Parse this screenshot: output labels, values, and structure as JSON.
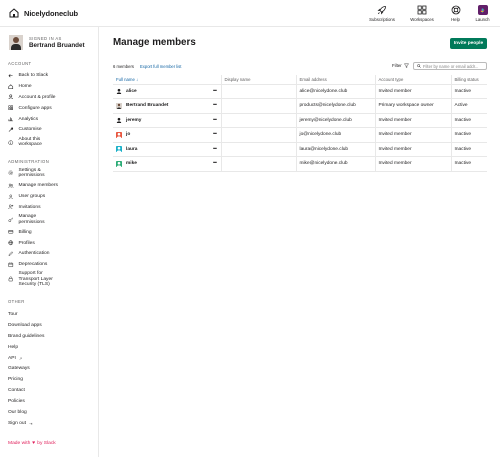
{
  "app": {
    "brand": "Nicelydoneclub"
  },
  "topnav": [
    {
      "label": "Subscriptions",
      "icon": "rocket-icon"
    },
    {
      "label": "Workspaces",
      "icon": "grid-icon"
    },
    {
      "label": "Help",
      "icon": "lifebuoy-icon"
    },
    {
      "label": "Launch",
      "icon": "slack-icon"
    }
  ],
  "user": {
    "signed_in_label": "SIGNED IN AS",
    "name": "Bertrand Bruandet"
  },
  "sidebar": {
    "account_heading": "ACCOUNT",
    "account_items": [
      {
        "label": "Back to Slack",
        "icon": "arrow-left-icon"
      },
      {
        "label": "Home",
        "icon": "home-icon"
      },
      {
        "label": "Account & profile",
        "icon": "user-icon"
      },
      {
        "label": "Configure apps",
        "icon": "apps-icon"
      },
      {
        "label": "Analytics",
        "icon": "chart-icon"
      },
      {
        "label": "Customise",
        "icon": "wrench-icon"
      },
      {
        "label": "About this workspace",
        "icon": "info-icon"
      }
    ],
    "admin_heading": "ADMINISTRATION",
    "admin_items": [
      {
        "label": "Settings & permissions",
        "icon": "gear-icon"
      },
      {
        "label": "Manage members",
        "icon": "users-icon"
      },
      {
        "label": "User groups",
        "icon": "user-group-icon"
      },
      {
        "label": "Invitations",
        "icon": "invite-icon"
      },
      {
        "label": "Manage permissions",
        "icon": "key-icon"
      },
      {
        "label": "Billing",
        "icon": "card-icon"
      },
      {
        "label": "Profiles",
        "icon": "globe-icon"
      },
      {
        "label": "Authentication",
        "icon": "pencil-icon"
      },
      {
        "label": "Deprecations",
        "icon": "calendar-icon"
      },
      {
        "label": "Support for Transport Layer Security (TLS)",
        "icon": "lock-icon"
      }
    ],
    "other_heading": "OTHER",
    "other_items": [
      {
        "label": "Tour",
        "external": false
      },
      {
        "label": "Download apps",
        "external": false
      },
      {
        "label": "Brand guidelines",
        "external": false
      },
      {
        "label": "Help",
        "external": false
      },
      {
        "label": "API",
        "external": true
      },
      {
        "label": "Gateways",
        "external": false
      },
      {
        "label": "Pricing",
        "external": false
      },
      {
        "label": "Contact",
        "external": false
      },
      {
        "label": "Policies",
        "external": false
      },
      {
        "label": "Our blog",
        "external": false
      },
      {
        "label": "Sign out",
        "external": true
      }
    ],
    "made_with": "Made with",
    "made_by": "by Slack"
  },
  "main": {
    "title": "Manage members",
    "invite_label": "Invite people",
    "members_count": "6 members",
    "export_label": "Export full member list",
    "filter_label": "Filter",
    "search_placeholder": "Filter by name or email addr...",
    "columns": [
      "Full name ↓",
      "Display name",
      "Email address",
      "Account type",
      "Billing status"
    ],
    "rows": [
      {
        "name": "alice",
        "display": "",
        "email": "alice@nicelydone.club",
        "type": "Invited member",
        "billing": "Inactive",
        "avatar_color": "#1d1c1d"
      },
      {
        "name": "Bertrand Bruandet",
        "display": "",
        "email": "products@nicelydone.club",
        "type": "Primary workspace owner",
        "billing": "Active",
        "avatar_color": "#6b4b3a"
      },
      {
        "name": "jeremy",
        "display": "",
        "email": "jeremy@nicelydone.club",
        "type": "Invited member",
        "billing": "Inactive",
        "avatar_color": "#1d1c1d"
      },
      {
        "name": "jo",
        "display": "",
        "email": "jo@nicelydone.club",
        "type": "Invited member",
        "billing": "Inactive",
        "avatar_color": "#e8563f"
      },
      {
        "name": "laura",
        "display": "",
        "email": "laura@nicelydone.club",
        "type": "Invited member",
        "billing": "Inactive",
        "avatar_color": "#1ab0c8"
      },
      {
        "name": "mike",
        "display": "",
        "email": "mike@nicelydone.club",
        "type": "Invited member",
        "billing": "Inactive",
        "avatar_color": "#2bac76"
      }
    ]
  }
}
